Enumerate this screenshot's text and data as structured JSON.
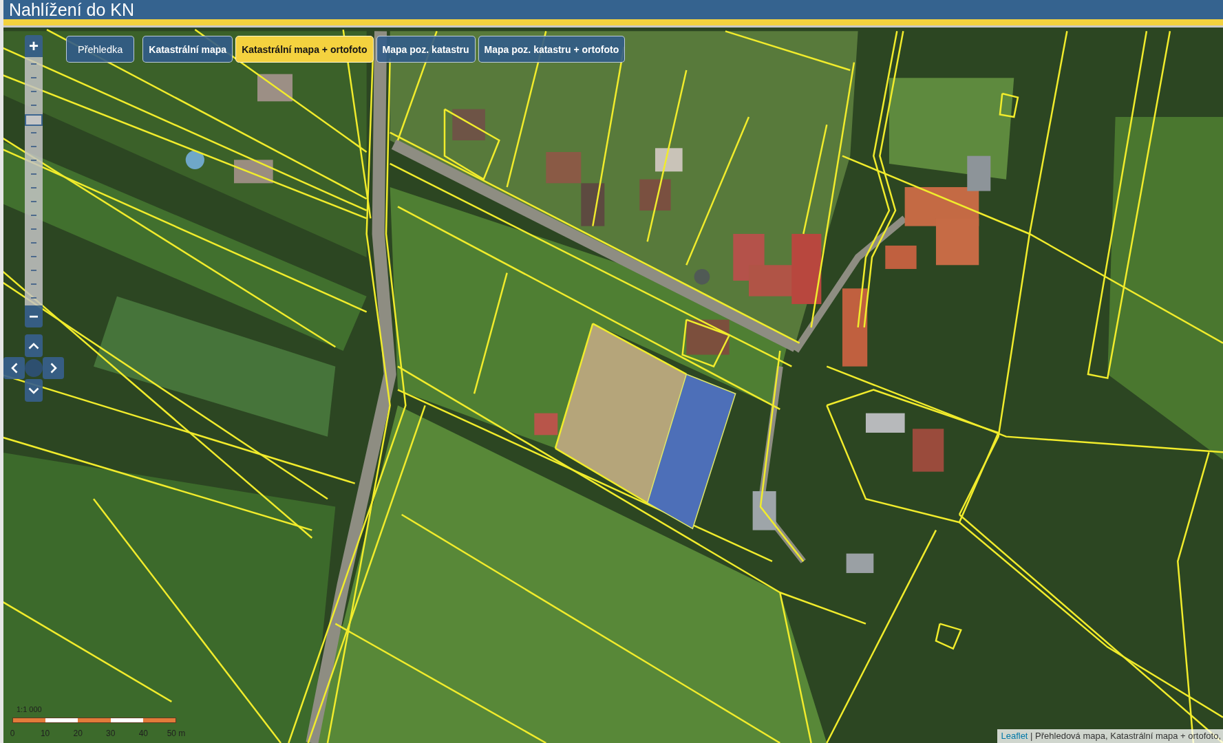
{
  "header": {
    "title": "Nahlížení do KN"
  },
  "layer_buttons": [
    {
      "label": "Přehledka",
      "kind": "overview",
      "selected": false
    },
    {
      "label": "Katastrální mapa",
      "kind": "layer",
      "selected": false
    },
    {
      "label": "Katastrální mapa + ortofoto",
      "kind": "layer",
      "selected": true
    },
    {
      "label": "Mapa poz. katastru",
      "kind": "layer",
      "selected": false
    },
    {
      "label": "Mapa poz. katastru + ortofoto",
      "kind": "layer",
      "selected": false
    }
  ],
  "zoom_control": {
    "zoom_in": "+",
    "zoom_out": "−",
    "level": 0.76
  },
  "scale": {
    "ratio": "1:1 000",
    "ticks": [
      "0",
      "10",
      "20",
      "30",
      "40",
      "50 m"
    ]
  },
  "attribution": {
    "link": "Leaflet",
    "separator": "|",
    "text": "Přehledová mapa, Katastrální mapa + ortofoto,"
  }
}
